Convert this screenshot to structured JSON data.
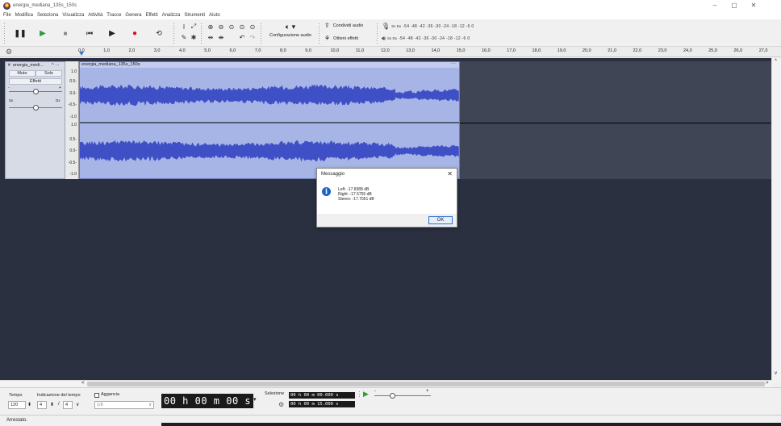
{
  "window": {
    "title": "energia_mediana_135s_150s",
    "controls": [
      "–",
      "▢",
      "✕"
    ]
  },
  "menu": [
    "File",
    "Modifica",
    "Seleziona",
    "Visualizza",
    "Attività",
    "Tracce",
    "Genera",
    "Effetti",
    "Analizza",
    "Strumenti",
    "Aiuto"
  ],
  "toolbar": {
    "audio_setup_label": "Configurazione audio",
    "share_audio_label": "Condividi audio",
    "get_effects_label": "Ottieni effetti",
    "meter_channel_label": "Sx\nDx",
    "meter_scale": "-54 -48 -42 -36 -30 -24 -18 -12 -6 0",
    "meter_scale_playback": "-54 -48 -42 -36 -30 -24 -18 -12 -6 0"
  },
  "ruler": {
    "ticks": [
      "0,0",
      "1,0",
      "2,0",
      "3,0",
      "4,0",
      "5,0",
      "6,0",
      "7,0",
      "8,0",
      "9,0",
      "10,0",
      "11,0",
      "12,0",
      "13,0",
      "14,0",
      "15,0",
      "16,0",
      "17,0",
      "18,0",
      "19,0",
      "20,0",
      "21,0",
      "22,0",
      "23,0",
      "24,0",
      "25,0",
      "26,0",
      "27,0"
    ]
  },
  "track": {
    "name": "energia_medi...",
    "mute_label": "Muto",
    "solo_label": "Solo",
    "effects_label": "Effetti",
    "pan_left": "Sx",
    "pan_right": "Dx",
    "clip_name": "energia_mediana_135s_150s",
    "scale_labels": [
      "1.0",
      "0.5-",
      "0.0-",
      "-0.5-",
      "-1.0"
    ]
  },
  "dialog": {
    "title": "Messaggio",
    "lines": [
      "Left: -17.8388 dB",
      "Right: -17.5755 dB",
      "Stereo: -17.7051 dB"
    ],
    "ok_label": "OK"
  },
  "bottom": {
    "tempo_label": "Tempo",
    "tempo_value": "120",
    "time_sig_label": "Indicazione del tempo",
    "time_sig_num": "4",
    "time_sig_den": "4",
    "snap_label": "Aggancia",
    "snap_value": "1/8",
    "big_time": "00 h 00 m 00 s",
    "selection_label": "Selezione",
    "sel_start": "00 h 00 m 00.000 s",
    "sel_end": "00 h 00 m 15.000 s"
  },
  "status": "Arrestato."
}
